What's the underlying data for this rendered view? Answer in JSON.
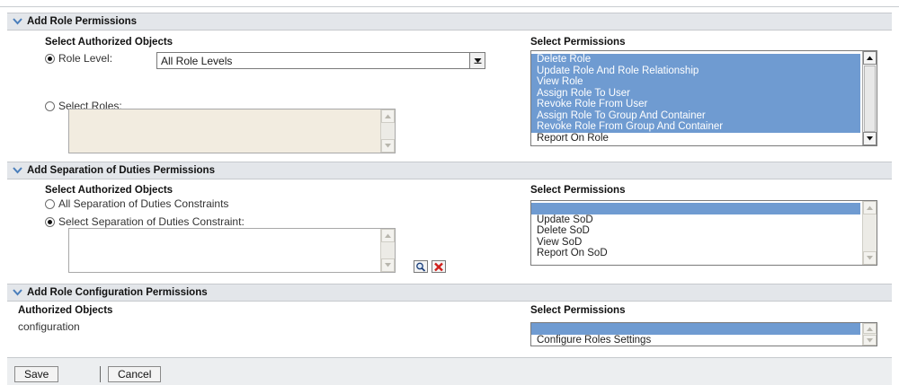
{
  "sections": {
    "role": {
      "title": "Add Role Permissions",
      "authorized_heading": "Select Authorized Objects",
      "permissions_heading": "Select Permissions",
      "role_level_label": "Role Level:",
      "role_level_value": "All Role Levels",
      "select_roles_label": "Select Roles:",
      "permissions": [
        {
          "label": "Delete Role",
          "selected": true
        },
        {
          "label": "Update Role And Role Relationship",
          "selected": true
        },
        {
          "label": "View Role",
          "selected": true
        },
        {
          "label": "Assign Role To User",
          "selected": true
        },
        {
          "label": "Revoke Role From User",
          "selected": true
        },
        {
          "label": "Assign Role To Group And Container",
          "selected": true
        },
        {
          "label": "Revoke Role From Group And Container",
          "selected": true
        },
        {
          "label": "Report On Role",
          "selected": false
        }
      ]
    },
    "sod": {
      "title": "Add Separation of Duties Permissions",
      "authorized_heading": "Select Authorized Objects",
      "permissions_heading": "Select Permissions",
      "all_label": "All Separation of Duties Constraints",
      "select_label": "Select Separation of Duties Constraint:",
      "permissions": [
        {
          "label": "",
          "selected": true
        },
        {
          "label": "Update SoD",
          "selected": false
        },
        {
          "label": "Delete SoD",
          "selected": false
        },
        {
          "label": "View SoD",
          "selected": false
        },
        {
          "label": "Report On SoD",
          "selected": false
        }
      ]
    },
    "config": {
      "title": "Add Role Configuration Permissions",
      "authorized_heading": "Authorized Objects",
      "permissions_heading": "Select Permissions",
      "object": "configuration",
      "permissions": [
        {
          "label": "",
          "selected": true
        },
        {
          "label": "Configure Roles Settings",
          "selected": false
        }
      ]
    }
  },
  "footer": {
    "save_label": "Save",
    "cancel_label": "Cancel"
  },
  "colors": {
    "selection": "#6f9bd1",
    "header_bg": "#e3e6ea",
    "accent_chevron": "#4a7ebb",
    "delete_red": "#d0201c"
  }
}
